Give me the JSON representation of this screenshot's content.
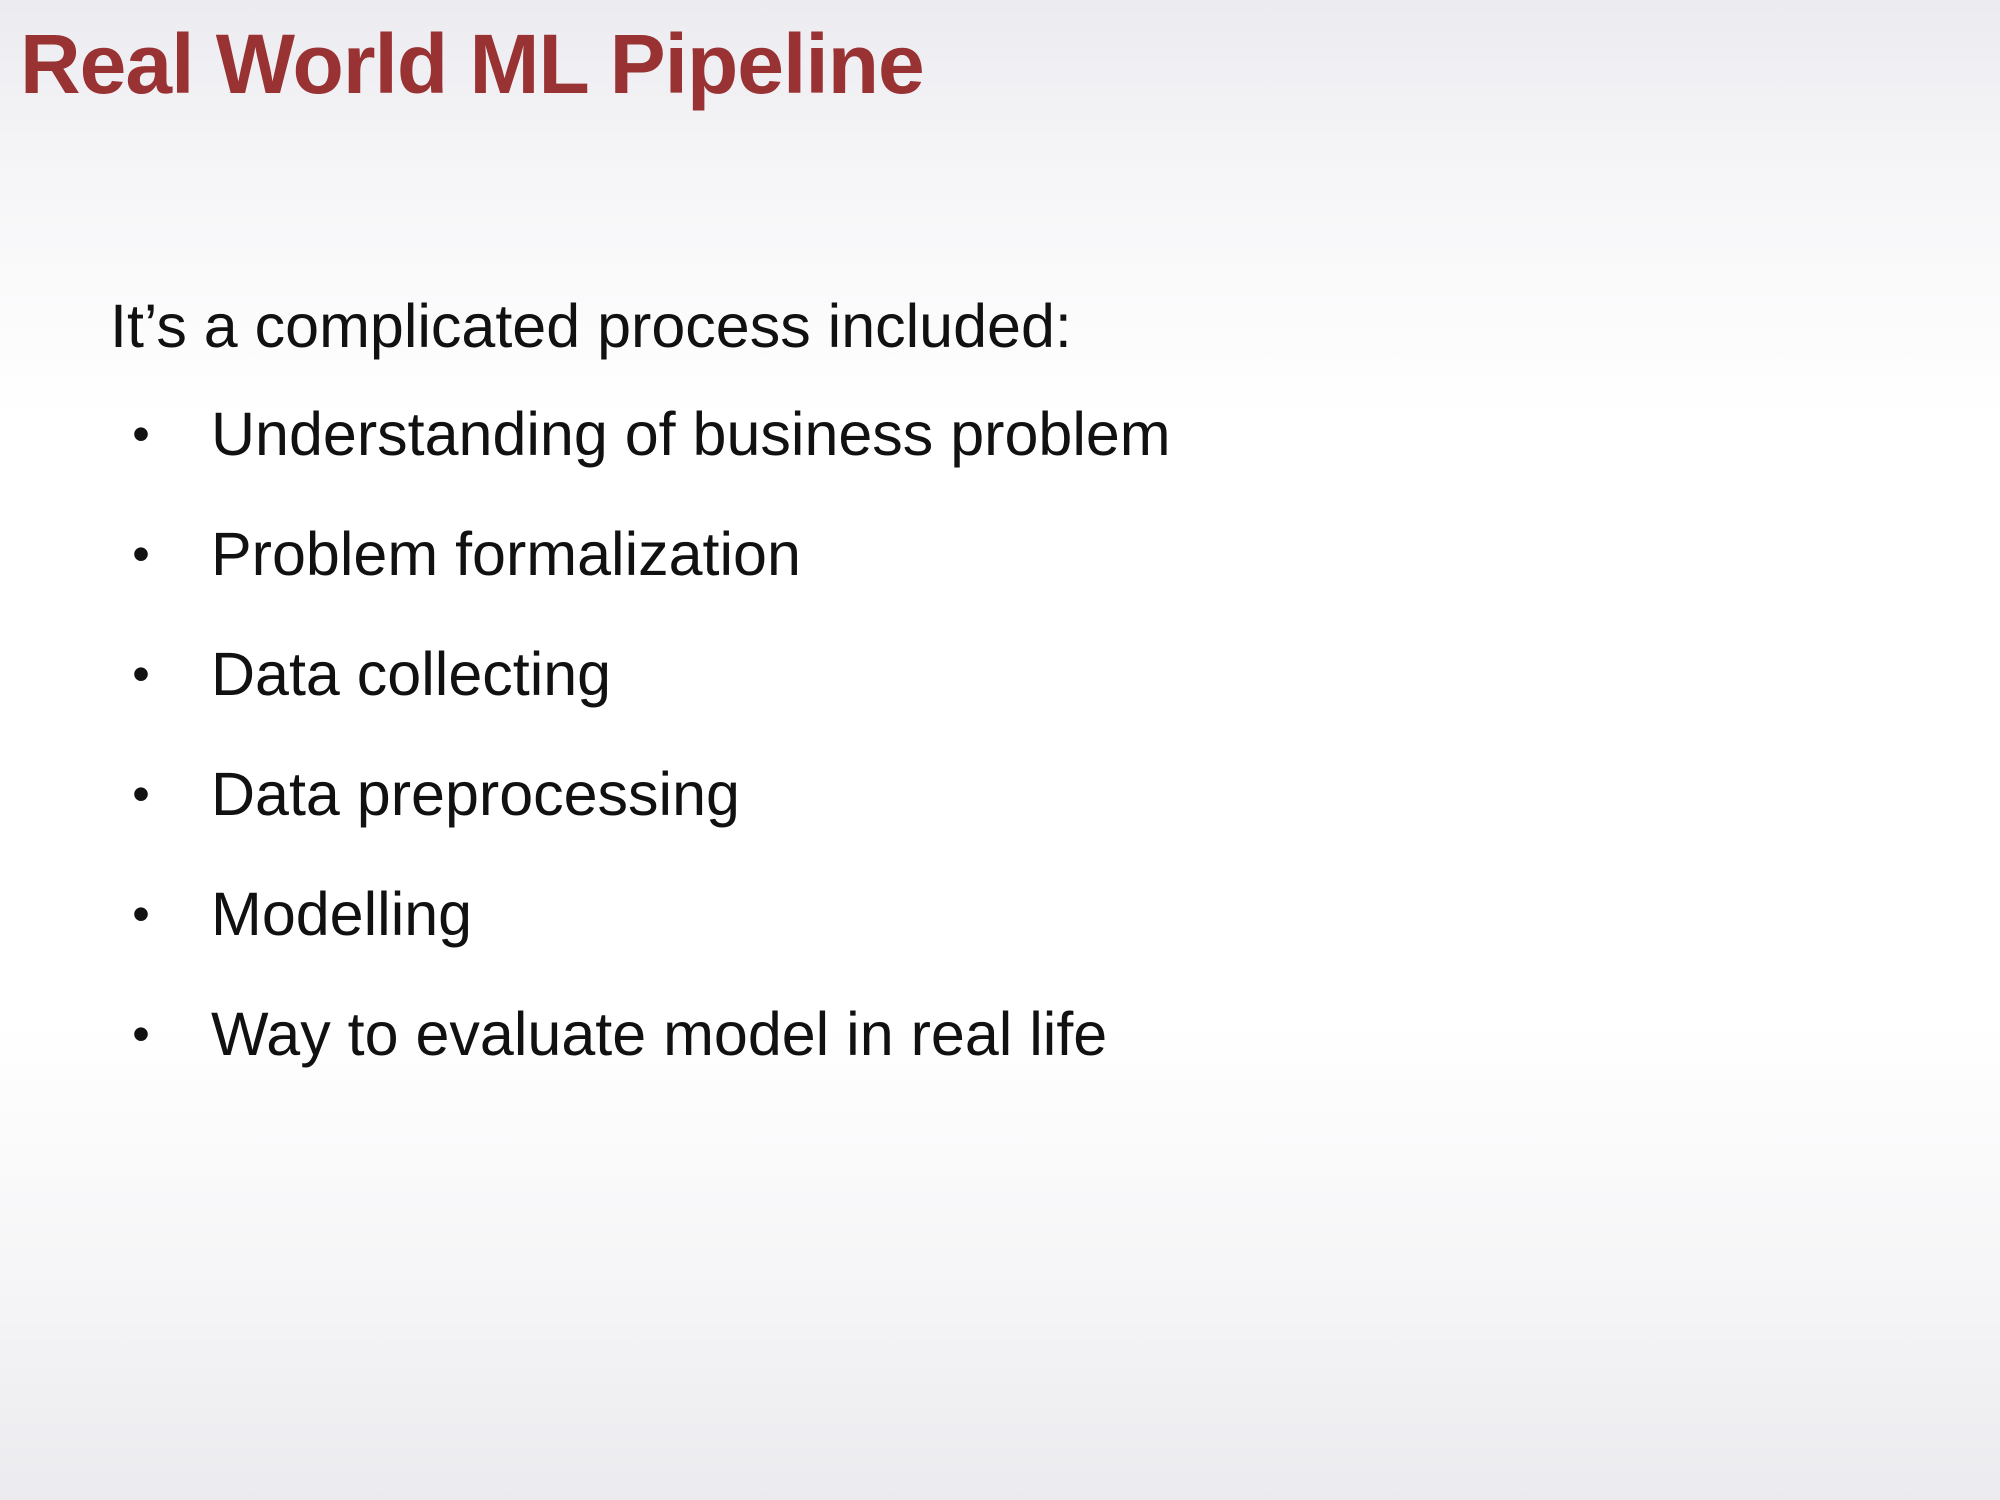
{
  "slide": {
    "title": "Real World ML Pipeline",
    "intro": "It’s a complicated process included:",
    "bullet_symbol": "•",
    "items": [
      "Understanding of business problem",
      "Problem formalization",
      "Data collecting",
      "Data preprocessing",
      "Modelling",
      "Way to evaluate model in real life"
    ]
  },
  "colors": {
    "title": "#993333",
    "body_text": "#111111",
    "background_top": "#ecebf0",
    "background_mid": "#ffffff",
    "background_bottom": "#ebebef"
  }
}
